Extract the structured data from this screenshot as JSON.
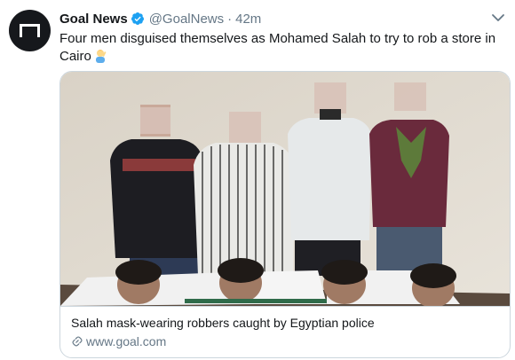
{
  "tweet": {
    "author_name": "Goal News",
    "handle": "@GoalNews",
    "separator": "·",
    "time": "42m",
    "text": "Four men disguised themselves as Mohamed Salah to try to rob a store in Cairo",
    "emoji_icon": "facepalm-icon"
  },
  "card": {
    "title": "Salah mask-wearing robbers caught by Egyptian police",
    "domain": "www.goal.com",
    "photo_description_icon": "news-photo"
  },
  "colors": {
    "verified_blue": "#1da1f2",
    "muted": "#657786",
    "border": "#ccd6dd",
    "text": "#14171a"
  }
}
